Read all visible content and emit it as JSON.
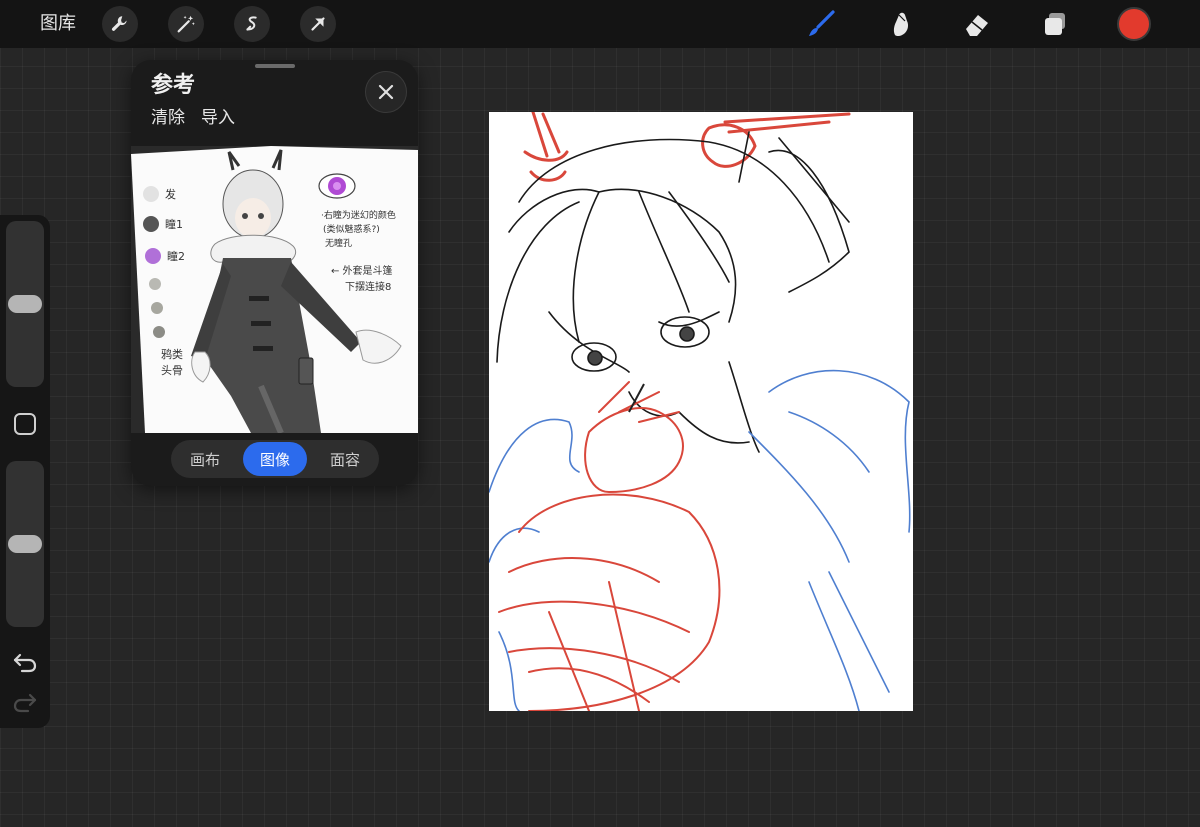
{
  "topbar": {
    "gallery_label": "图库",
    "left_tools": [
      "wrench-icon",
      "magic-wand-icon",
      "selection-icon",
      "transform-arrow-icon"
    ],
    "right_tools": [
      "brush-icon",
      "smudge-icon",
      "eraser-icon",
      "layers-icon"
    ],
    "active_color": "#e23a2d",
    "active_tool_color": "#2c6bed"
  },
  "sidebar": {
    "size_slider_level": 0.5,
    "opacity_slider_level": 0.5
  },
  "reference": {
    "title": "参考",
    "clear_label": "清除",
    "import_label": "导入",
    "tabs": [
      {
        "label": "画布",
        "active": false
      },
      {
        "label": "图像",
        "active": true
      },
      {
        "label": "面容",
        "active": false
      }
    ],
    "note_labels": [
      "发",
      "瞳1",
      "瞳2"
    ],
    "note_text": [
      "·右瞳为迷幻的颜色",
      "(类似魅惑系?)",
      "无瞳孔",
      "← 外套是斗篷",
      "下摆连接8",
      "鸦类",
      "头骨"
    ]
  }
}
